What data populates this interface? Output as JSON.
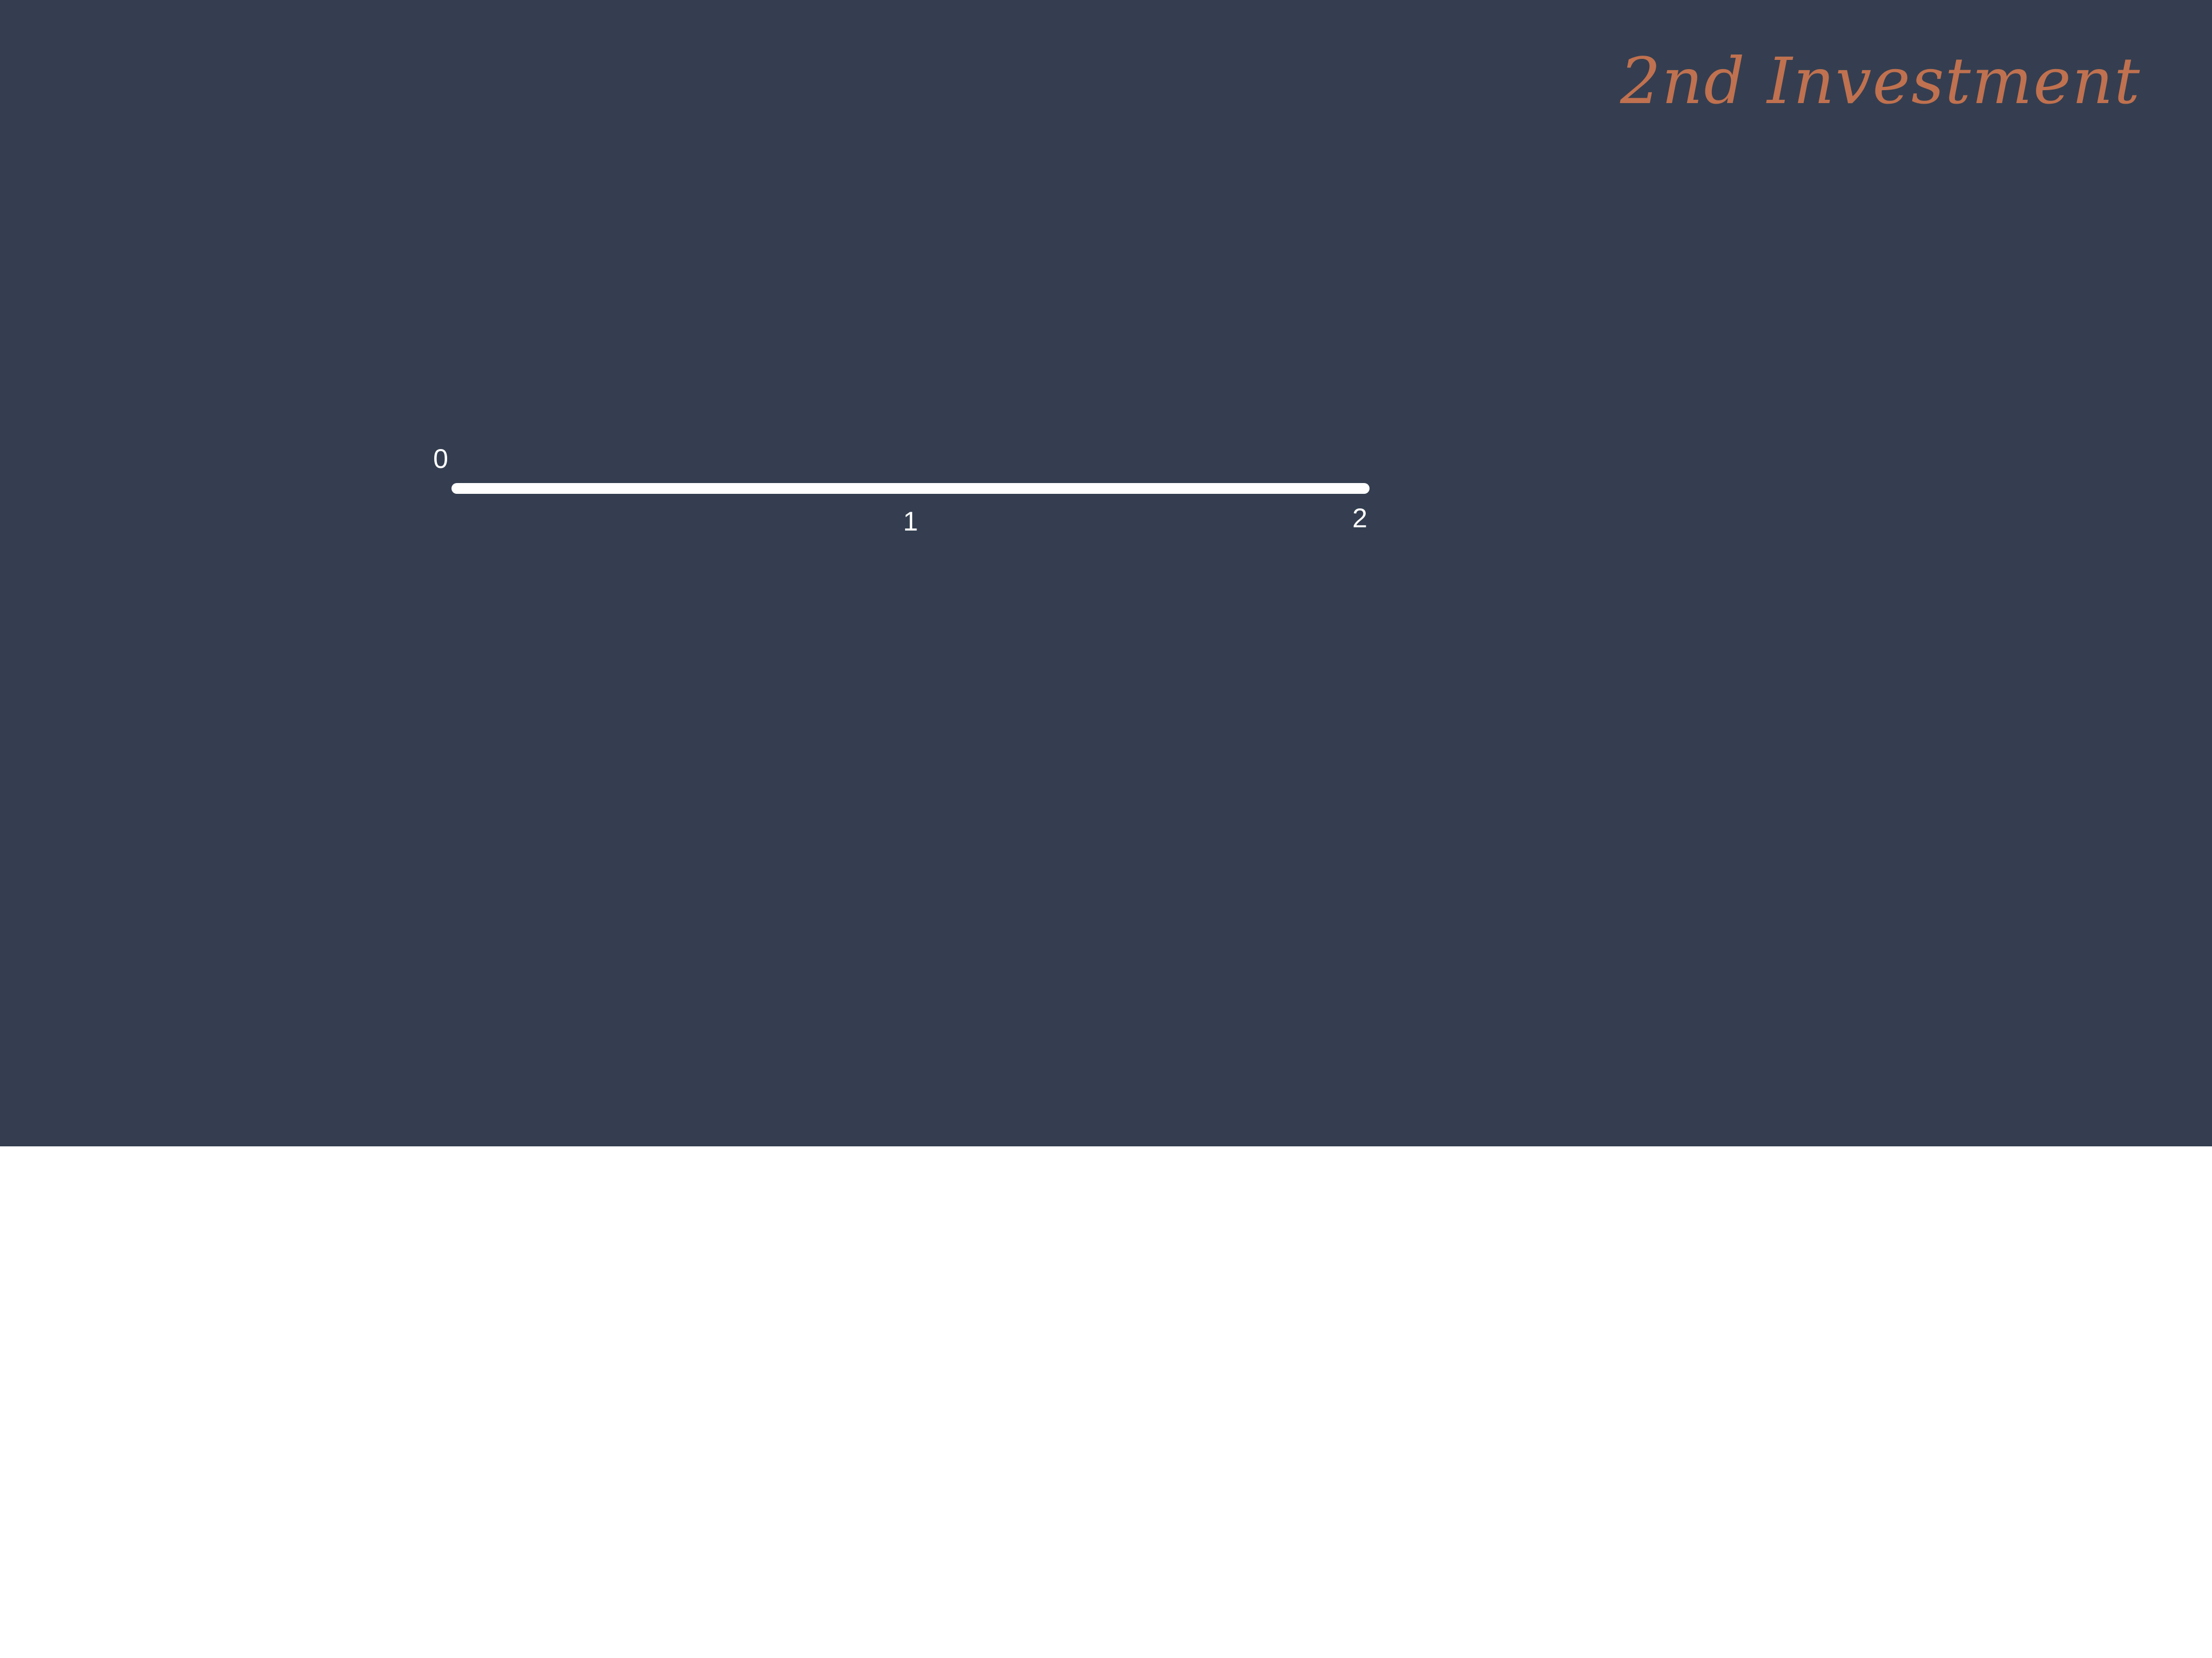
{
  "slide": {
    "title": "2nd Investment",
    "title_color": "#c0714f",
    "background_color": "#343e50",
    "line_color": "#ffffff"
  },
  "timeline": {
    "range": [
      0,
      2
    ],
    "ticks": [
      {
        "value": 0,
        "label": "0",
        "side": "above"
      },
      {
        "value": 1,
        "label": "1",
        "side": "below"
      },
      {
        "value": 2,
        "label": "2",
        "side": "below"
      }
    ]
  }
}
